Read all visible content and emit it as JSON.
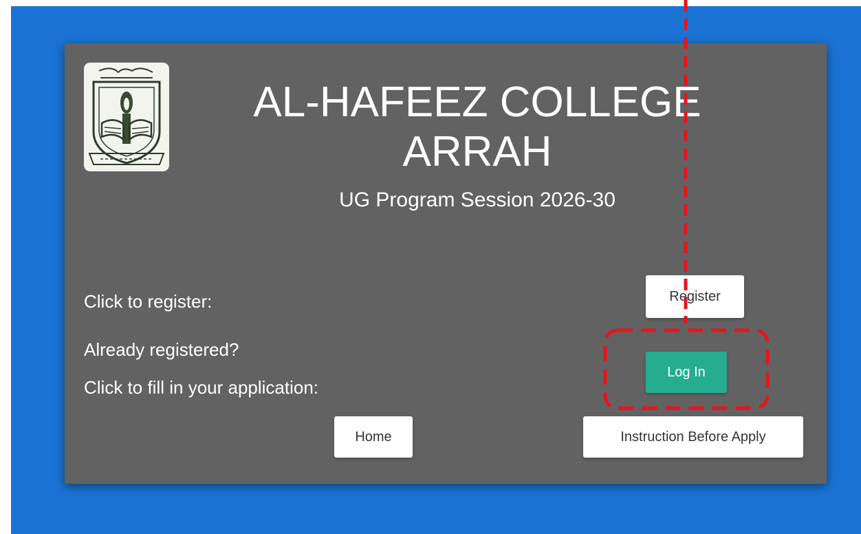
{
  "college": {
    "title_line1": "AL-HAFEEZ COLLEGE",
    "title_line2": "ARRAH",
    "session": "UG Program Session 2026-30",
    "logo_icon": "college-emblem-icon"
  },
  "register_row": {
    "label": "Click to register:",
    "button_label": "Register"
  },
  "login_row": {
    "label_line1": "Already registered?",
    "label_line2": "Click to fill in your application:",
    "button_label": "Log In"
  },
  "footer_buttons": {
    "home_label": "Home",
    "instructions_label": "Instruction Before Apply"
  },
  "colors": {
    "page_background": "#1a73d4",
    "card_background": "#626262",
    "login_button": "#26ad8f",
    "annotation": "#e8141c"
  }
}
